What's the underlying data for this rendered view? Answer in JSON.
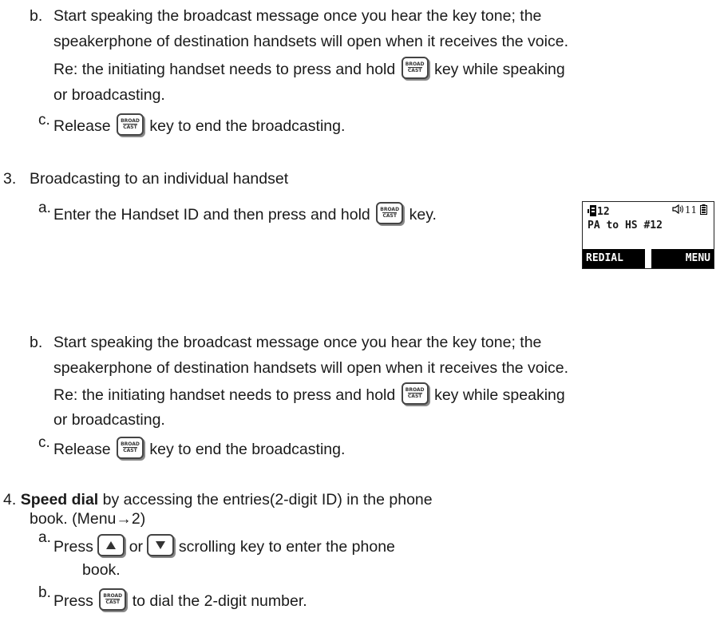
{
  "key_icons": {
    "broadcast": "broadcast-key-icon",
    "broadcast_text_top": "BROAD",
    "broadcast_text_bottom": "CAST",
    "up": "up-arrow-key-icon",
    "down": "down-arrow-key-icon"
  },
  "top_section": {
    "b_label": "b.",
    "b_line1": "Start speaking the broadcast message once you hear the key tone; the",
    "b_line2": "speakerphone of destination  handsets will open when it receives the voice.",
    "b_line3_pre": "Re: the initiating handset needs to press and hold",
    "b_line3_post": "key while speaking",
    "b_line4": "or broadcasting.",
    "c_label": "c.",
    "c_pre": "Release",
    "c_post": "key to end the broadcasting."
  },
  "section3": {
    "num": "3.",
    "title": "Broadcasting to an individual handset",
    "a_label": "a.",
    "a_pre": "Enter the Handset ID and then press and hold",
    "a_post": "key.",
    "b_label": "b.",
    "b_line1": "Start speaking the broadcast message once you hear the key tone; the",
    "b_line2": "speakerphone of destination  handsets will open when it receives the voice.",
    "b_line3_pre": "Re: the initiating handset needs to press and hold",
    "b_line3_post": "key while speaking",
    "b_line4": "or broadcasting.",
    "c_label": "c.",
    "c_pre": "Release",
    "c_post": "key to end the broadcasting."
  },
  "lcd": {
    "line1": "12",
    "status": "11",
    "line2": "PA to HS #12",
    "soft_left": "REDIAL",
    "soft_right": "MENU"
  },
  "section4": {
    "num": "4.",
    "bold": "Speed dial",
    "line1_rest": " by accessing the entries(2-digit ID) in the phone",
    "line2": "book. (Menu→2)",
    "a_label": "a.",
    "a_pre": "Press",
    "a_mid": "or",
    "a_post": "scrolling key to enter the phone",
    "a_line2": "book.",
    "b_label": "b.",
    "b_pre": "Press",
    "b_post": "to dial the 2-digit number."
  }
}
